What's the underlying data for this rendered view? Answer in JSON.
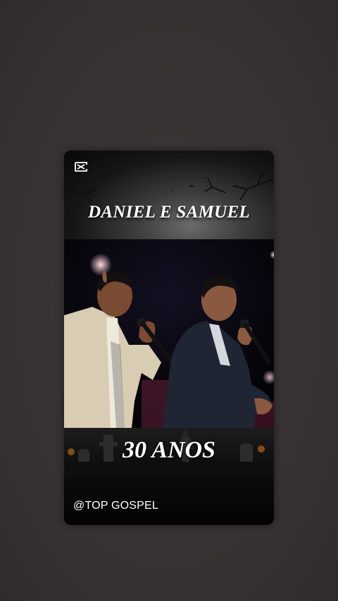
{
  "video": {
    "title_top": "DANIEL E SAMUEL",
    "title_bottom": "30 ANOS",
    "handle": "@TOP GOSPEL",
    "watermark_icon": "capcut-logo-icon"
  },
  "colors": {
    "background": "#3a3536",
    "card": "#050505",
    "text": "#ffffff"
  }
}
